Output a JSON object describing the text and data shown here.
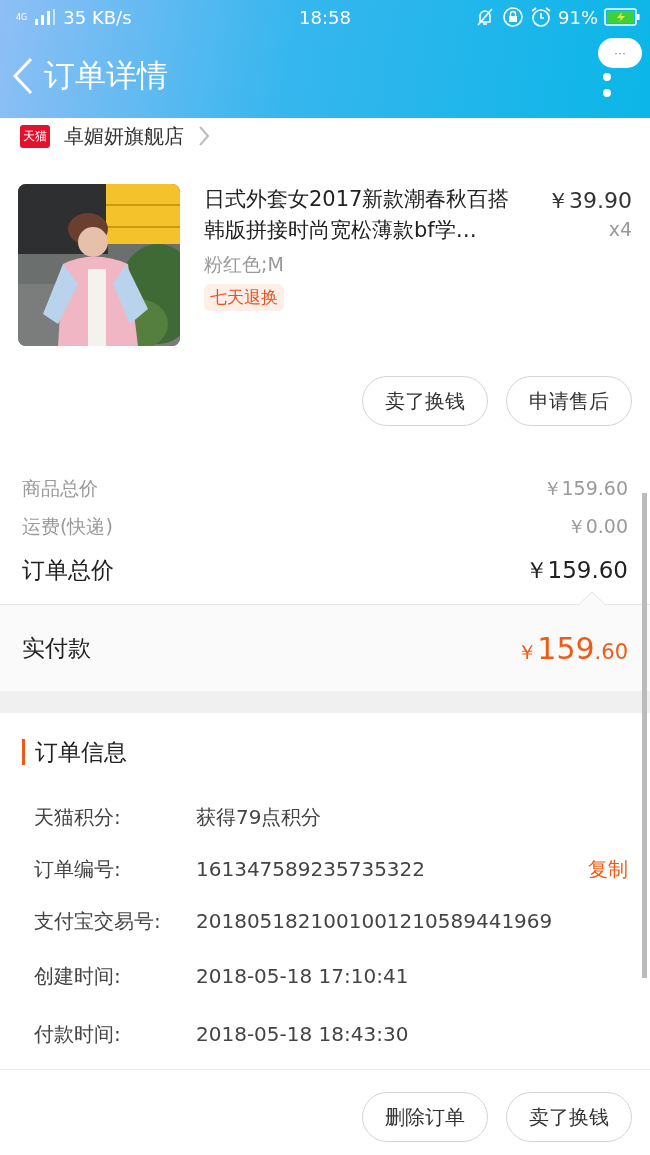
{
  "status_bar": {
    "network": "4G",
    "speed": "35 KB/s",
    "time": "18:58",
    "battery": "91%",
    "charging": true
  },
  "header": {
    "title": "订单详情",
    "menu_button": "···"
  },
  "store": {
    "badge": "天猫",
    "name": "卓媚妍旗舰店"
  },
  "product": {
    "kind": "picture",
    "title": "日式外套女2017新款潮春秋百搭韩版拼接时尚宽松薄款bf学…",
    "variant": "粉红色;M",
    "tag": "七天退换",
    "price": "￥39.90",
    "quantity": "x4"
  },
  "item_actions": [
    "卖了换钱",
    "申请售后"
  ],
  "price_rows": [
    {
      "label": "商品总价",
      "value": "￥159.60",
      "kind": "minor"
    },
    {
      "label": "运费(快递)",
      "value": "￥0.00",
      "kind": "minor"
    },
    {
      "label": "订单总价",
      "value": "￥159.60",
      "kind": "total"
    }
  ],
  "paid": {
    "label": "实付款",
    "currency": "￥",
    "integer": "159",
    "decimal": ".60"
  },
  "order_info": {
    "title": "订单信息",
    "rows": [
      {
        "label": "天猫积分:",
        "value": "获得79点积分"
      },
      {
        "label": "订单编号:",
        "value": "161347589235735322",
        "action": "复制"
      },
      {
        "label": "支付宝交易号:",
        "value": "2018051821001001210589441969"
      },
      {
        "label": "创建时间:",
        "value": "2018-05-18 17:10:41"
      },
      {
        "label": "付款时间:",
        "value": "2018-05-18 18:43:30"
      }
    ]
  },
  "bottom_actions": [
    "删除订单",
    "卖了换钱"
  ]
}
